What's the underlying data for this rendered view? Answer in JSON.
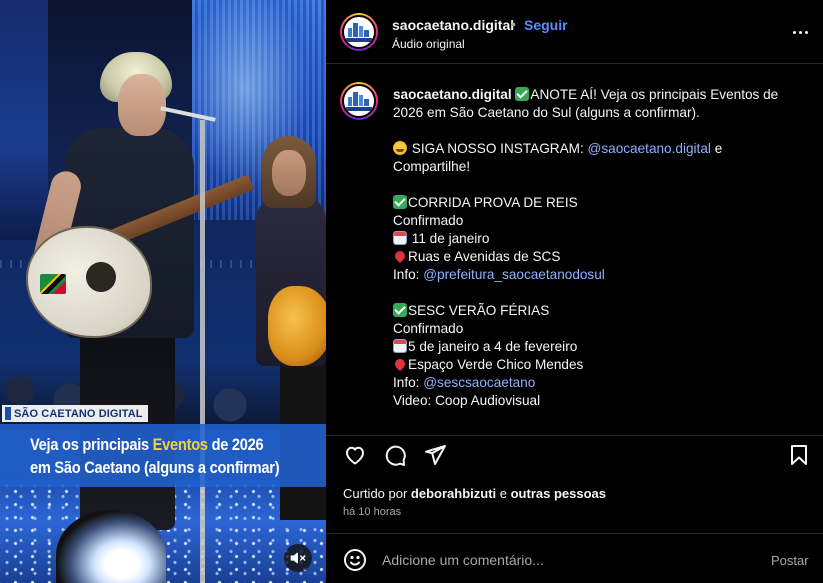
{
  "media": {
    "watermark": "SÃO CAETANO DIGITAL",
    "overlay_line1_pre": "Veja os principais ",
    "overlay_line1_highlight": "Eventos",
    "overlay_line1_post": " de 2026",
    "overlay_line2": "em São Caetano (alguns a confirmar)",
    "mute_icon": "speaker-muted-icon",
    "highlight_color": "#f3d23a",
    "overlay_color": "#2162cf"
  },
  "header": {
    "username": "saocaetano.digital",
    "separator": "•",
    "follow_label": "Seguir",
    "audio_label": "Áudio original",
    "more_icon": "more-options-icon"
  },
  "caption": {
    "username": "saocaetano.digital",
    "intro_a": "ANOTE AÍ! Veja os principais Eventos de",
    "intro_b": "2026 em São Caetano do Sul (alguns a confirmar).",
    "follow_prefix": "SIGA NOSSO INSTAGRAM: ",
    "follow_mention": "@saocaetano.digital",
    "follow_suffix": " e",
    "follow_line2": "Compartilhe!",
    "events": [
      {
        "title": "CORRIDA PROVA DE REIS",
        "status": "Confirmado",
        "date": "11 de janeiro",
        "place": "Ruas e Avenidas de SCS",
        "info_label": "Info: ",
        "info_mention": "@prefeitura_saocaetanodosul"
      },
      {
        "title": "SESC VERÃO FÉRIAS",
        "status": "Confirmado",
        "date": "5 de janeiro a 4 de fevereiro",
        "place": "Espaço Verde Chico Mendes",
        "info_label": "Info: ",
        "info_mention": "@sescsaocaetano",
        "video": "Video: Coop Audiovisual"
      }
    ]
  },
  "actions": {
    "like_icon": "heart-icon",
    "comment_icon": "comment-bubble-icon",
    "share_icon": "send-icon",
    "save_icon": "bookmark-icon"
  },
  "likes": {
    "prefix": "Curtido por ",
    "user": "deborahbizuti",
    "middle": " e ",
    "others": "outras pessoas"
  },
  "timestamp": "há 10 horas",
  "comment": {
    "placeholder": "Adicione um comentário...",
    "post_label": "Postar",
    "emoji_icon": "smiley-icon"
  },
  "colors": {
    "link": "#8fb1ff",
    "follow": "#5b8cff",
    "background": "#000000"
  }
}
